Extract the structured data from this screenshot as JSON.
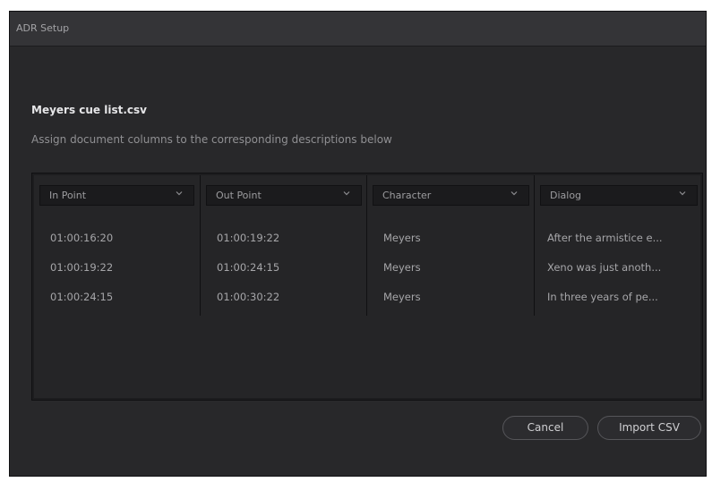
{
  "dialog": {
    "title": "ADR Setup",
    "file_name": "Meyers cue list.csv",
    "instructions": "Assign document columns to the corresponding descriptions below"
  },
  "columns": [
    {
      "label": "In Point",
      "icon": "chevron-down-icon"
    },
    {
      "label": "Out Point",
      "icon": "chevron-down-icon"
    },
    {
      "label": "Character",
      "icon": "chevron-down-icon"
    },
    {
      "label": "Dialog",
      "icon": "chevron-down-icon"
    }
  ],
  "rows": [
    [
      "01:00:16:20",
      "01:00:19:22",
      "Meyers",
      "After the armistice e..."
    ],
    [
      "01:00:19:22",
      "01:00:24:15",
      "Meyers",
      "Xeno was just anoth..."
    ],
    [
      "01:00:24:15",
      "01:00:30:22",
      "Meyers",
      "In three years of pe..."
    ]
  ],
  "buttons": {
    "cancel": "Cancel",
    "import": "Import CSV"
  }
}
